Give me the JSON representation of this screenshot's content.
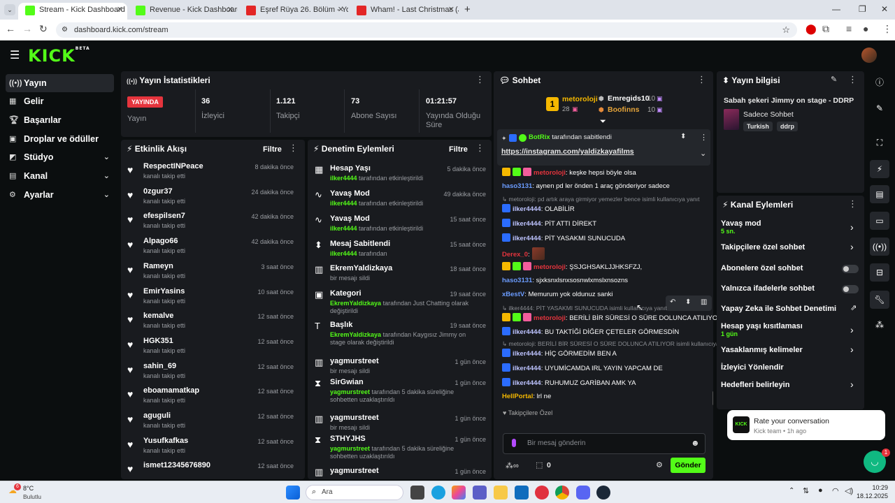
{
  "browser": {
    "tabs": [
      {
        "label": "Stream - Kick Dashboard",
        "active": true
      },
      {
        "label": "Revenue - Kick Dashboard",
        "active": false
      },
      {
        "label": "Eşref Rüya 26. Bölüm - YouTube",
        "active": false
      },
      {
        "label": "Wham! - Last Christmas (JOHA",
        "active": false
      }
    ],
    "url": "dashboard.kick.com/stream"
  },
  "header": {
    "logo": "KICK",
    "logo_badge": "BETA"
  },
  "sidebar": {
    "items": [
      {
        "label": "Yayın",
        "icon": "broadcast-icon"
      },
      {
        "label": "Gelir",
        "icon": "revenue-icon"
      },
      {
        "label": "Başarılar",
        "icon": "trophy-icon"
      },
      {
        "label": "Droplar ve ödüller",
        "icon": "gift-icon"
      },
      {
        "label": "Stüdyo",
        "icon": "studio-icon"
      },
      {
        "label": "Kanal",
        "icon": "channel-icon"
      },
      {
        "label": "Ayarlar",
        "icon": "gear-icon"
      }
    ]
  },
  "stats": {
    "title": "Yayın İstatistikleri",
    "live_badge": "YAYINDA",
    "live_label": "Yayın",
    "viewers_value": "36",
    "viewers_label": "İzleyici",
    "followers_value": "1.121",
    "followers_label": "Takipçi",
    "subs_value": "73",
    "subs_label": "Abone Sayısı",
    "duration_value": "01:21:57",
    "duration_label": "Yayında Olduğu Süre"
  },
  "activity": {
    "title": "Etkinlik Akışı",
    "filter": "Filtre",
    "items": [
      {
        "name": "RespectINPeace",
        "sub": "kanalı takip etti",
        "time": "8 dakika önce"
      },
      {
        "name": "0zgur37",
        "sub": "kanalı takip etti",
        "time": "24 dakika önce"
      },
      {
        "name": "efespilsen7",
        "sub": "kanalı takip etti",
        "time": "42 dakika önce"
      },
      {
        "name": "Alpago66",
        "sub": "kanalı takip etti",
        "time": "42 dakika önce"
      },
      {
        "name": "Rameyn",
        "sub": "kanalı takip etti",
        "time": "3 saat önce"
      },
      {
        "name": "EmirYasins",
        "sub": "kanalı takip etti",
        "time": "10 saat önce"
      },
      {
        "name": "kemalve",
        "sub": "kanalı takip etti",
        "time": "12 saat önce"
      },
      {
        "name": "HGK351",
        "sub": "kanalı takip etti",
        "time": "12 saat önce"
      },
      {
        "name": "sahin_69",
        "sub": "kanalı takip etti",
        "time": "12 saat önce"
      },
      {
        "name": "eboamamatkap",
        "sub": "kanalı takip etti",
        "time": "12 saat önce"
      },
      {
        "name": "aguguli",
        "sub": "kanalı takip etti",
        "time": "12 saat önce"
      },
      {
        "name": "Yusufkafkas",
        "sub": "kanalı takip etti",
        "time": "12 saat önce"
      },
      {
        "name": "ismet12345676890",
        "sub": "",
        "time": "12 saat önce"
      }
    ]
  },
  "moderation": {
    "title": "Denetim Eylemleri",
    "filter": "Filtre",
    "items": [
      {
        "name": "Hesap Yaşı",
        "user": "ilker4444",
        "rest": " tarafından etkinleştirildi",
        "time": "5 dakika önce"
      },
      {
        "name": "Yavaş Mod",
        "user": "ilker4444",
        "rest": " tarafından etkinleştirildi",
        "time": "49 dakika önce"
      },
      {
        "name": "Yavaş Mod",
        "user": "ilker4444",
        "rest": " tarafından etkinleştirildi",
        "time": "15 saat önce"
      },
      {
        "name": "Mesaj Sabitlendi",
        "user": "ilker4444",
        "rest": " tarafından",
        "time": "15 saat önce"
      },
      {
        "name": "EkremYaldizkaya",
        "user": "",
        "rest": "bir mesajı sildi",
        "time": "18 saat önce"
      },
      {
        "name": "Kategori",
        "user": "EkremYaldizkaya",
        "rest": " tarafından Just Chatting olarak değiştirildi",
        "time": "19 saat önce"
      },
      {
        "name": "Başlık",
        "user": "EkremYaldizkaya",
        "rest": " tarafından Kaygısız Jimmy on stage olarak değiştirildi",
        "time": "19 saat önce"
      },
      {
        "name": "yagmurstreet",
        "user": "",
        "rest": "bir mesajı sildi",
        "time": "1 gün önce"
      },
      {
        "name": "SirGwian",
        "user": "yagmurstreet",
        "rest": " tarafından 5 dakika süreliğine sohbetten uzaklaştırıldı",
        "time": "1 gün önce"
      },
      {
        "name": "yagmurstreet",
        "user": "",
        "rest": "bir mesajı sildi",
        "time": "1 gün önce"
      },
      {
        "name": "STHYJHS",
        "user": "yagmurstreet",
        "rest": " tarafından 5 dakika süreliğine sohbetten uzaklaştırıldı",
        "time": "1 gün önce"
      },
      {
        "name": "yagmurstreet",
        "user": "",
        "rest": "",
        "time": "1 gün önce"
      }
    ]
  },
  "chat": {
    "title": "Sohbet",
    "leaders": [
      {
        "rank": "1",
        "name": "metoroloji",
        "count": "28"
      },
      {
        "name": "Emregids10",
        "count": "10"
      },
      {
        "name": "Boofinns",
        "count": "10"
      }
    ],
    "pinned_by": "BotRix",
    "pinned_by_rest": " tarafından sabitlendi",
    "pinned_link": "https://instagram.com/yaldizkayafilms",
    "messages": [
      {
        "user": "metoroloji",
        "color": "#e5343d",
        "text": ": keşke hepsi böyle olsa",
        "badges": "cgp",
        "sys": false
      },
      {
        "user": "haso3131",
        "color": "#6b9cff",
        "text": ": aynen pd ler önden 1 araç gönderiyor sadece",
        "badges": "",
        "sys": false
      },
      {
        "user": "",
        "color": "",
        "text": "metoroloji: pd artık araya girmiyor yemezler bence isimli kullanıcıya yanıt",
        "badges": "",
        "sys": true
      },
      {
        "user": "ilker4444",
        "color": "#bdc3ff",
        "text": ": OLABİLİR",
        "badges": "k",
        "sys": false
      },
      {
        "user": "ilker4444",
        "color": "#bdc3ff",
        "text": ": PİT ATTI DİREKT",
        "badges": "k",
        "sys": false
      },
      {
        "user": "ilker4444",
        "color": "#bdc3ff",
        "text": ": PİT YASAKMI SUNUCUDA",
        "badges": "k",
        "sys": false
      },
      {
        "user": "Derex_0",
        "color": "#e5343d",
        "text": ":",
        "badges": "",
        "sys": false
      },
      {
        "user": "metoroloji",
        "color": "#e5343d",
        "text": ": ŞSJGHSAKLJJHKSFZJ,",
        "badges": "cgp",
        "sys": false
      },
      {
        "user": "haso3131",
        "color": "#6b9cff",
        "text": ": sjxksnxlsnxsosnwlxmslxnsozns",
        "badges": "",
        "sys": false
      },
      {
        "user": "xBestV",
        "color": "#6b9cff",
        "text": ": Memurum yok oldunuz sanki",
        "badges": "",
        "sys": false
      },
      {
        "user": "",
        "color": "",
        "text": "ilker4444: PİT YASAKMI SUNUCUDA isimli kullanıcıya yanıt",
        "badges": "",
        "sys": true
      },
      {
        "user": "metoroloji",
        "color": "#e5343d",
        "text": ": BERİLİ BİR SÜRESİ O SÜRE DOLUNCA ATILIYOR",
        "badges": "cgp",
        "sys": false
      },
      {
        "user": "ilker4444",
        "color": "#bdc3ff",
        "text": ": BU TAKTİĞİ DİĞER ÇETELER GÖRMESDİN",
        "badges": "k",
        "sys": false
      },
      {
        "user": "",
        "color": "",
        "text": "metoroloji: BERİLİ BİR SÜRESİ O SÜRE DOLUNCA ATILIYOR isimli kullanıcıya",
        "badges": "",
        "sys": true
      },
      {
        "user": "ilker4444",
        "color": "#bdc3ff",
        "text": ": HİÇ GÖRMEDİM BEN A",
        "badges": "k",
        "sys": false
      },
      {
        "user": "ilker4444",
        "color": "#bdc3ff",
        "text": ": UYUMİCAMDA IRL YAYIN YAPCAM DE",
        "badges": "k",
        "sys": false
      },
      {
        "user": "ilker4444",
        "color": "#bdc3ff",
        "text": ": RUHUMUZ GARİBAN AMK YA",
        "badges": "k",
        "sys": false
      },
      {
        "user": "HellPortal",
        "color": "#f5b800",
        "text": ": lrl ne",
        "badges": "",
        "sys": false
      }
    ],
    "followers_only": "Takipçilere Özel",
    "input_placeholder": "Bir mesaj gönderin",
    "points": "0",
    "send": "Gönder"
  },
  "streaminfo": {
    "title": "Yayın bilgisi",
    "stream_title": "Sabah şekeri Jimmy on stage - DDRP",
    "category": "Sadece Sohbet",
    "tags": [
      "Turkish",
      "ddrp"
    ]
  },
  "channel_actions": {
    "title": "Kanal Eylemleri",
    "items": [
      {
        "label": "Yavaş mod",
        "sub": "5 sn.",
        "ctrl": "chevron"
      },
      {
        "label": "Takipçilere özel sohbet",
        "sub": "",
        "ctrl": "chevron"
      },
      {
        "label": "Abonelere özel sohbet",
        "sub": "",
        "ctrl": "toggle"
      },
      {
        "label": "Yalnızca ifadelerle sohbet",
        "sub": "",
        "ctrl": "toggle"
      },
      {
        "label": "Yapay Zeka ile Sohbet Denetimi",
        "sub": "",
        "ctrl": "external"
      },
      {
        "label": "Hesap yaşı kısıtlaması",
        "sub": "1 gün",
        "ctrl": "chevron"
      },
      {
        "label": "Yasaklanmış kelimeler",
        "sub": "",
        "ctrl": "chevron"
      },
      {
        "label": "İzleyici Yönlendir",
        "sub": "",
        "ctrl": "none"
      },
      {
        "label": "Hedefleri belirleyin",
        "sub": "",
        "ctrl": "chevron"
      }
    ]
  },
  "toast": {
    "title": "Rate your conversation",
    "sub": "Kick team • 1h ago",
    "brand": "KICK",
    "badge": "1"
  },
  "taskbar": {
    "weather_temp": "8°C",
    "weather_desc": "Bulutlu",
    "weather_badge": "6",
    "search": "Ara",
    "time": "10:29",
    "date": "18.12.2025"
  },
  "colors": {
    "accent": "#53fc18",
    "bg": "#0b0e0f",
    "panel": "#191b1f",
    "live": "#e5343d"
  }
}
